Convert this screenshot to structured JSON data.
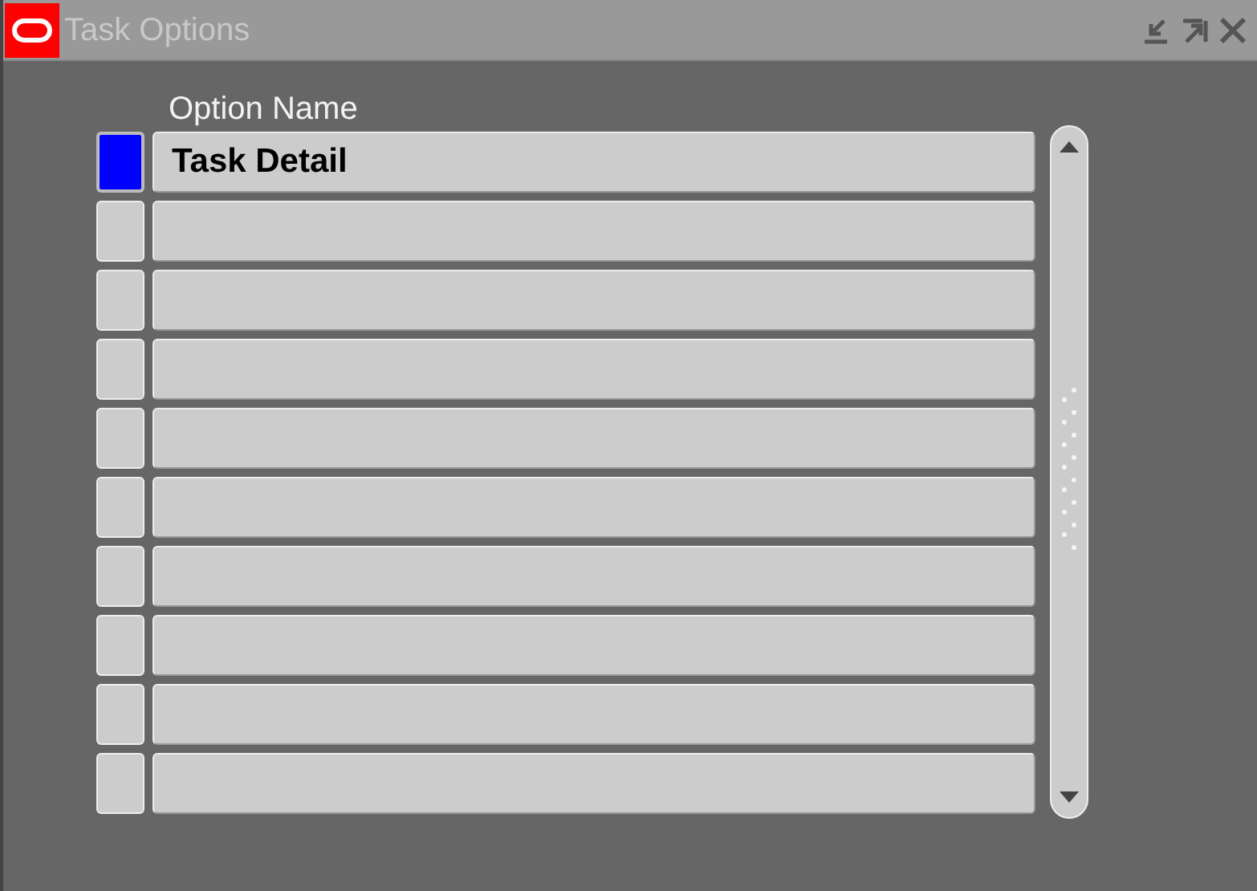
{
  "window": {
    "title": "Task Options"
  },
  "table": {
    "columns": [
      "Option Name"
    ],
    "rows": [
      {
        "value": "Task Detail",
        "selected": true
      },
      {
        "selected": false
      },
      {
        "selected": false
      },
      {
        "selected": false
      },
      {
        "selected": false
      },
      {
        "selected": false
      },
      {
        "selected": false
      },
      {
        "selected": false
      },
      {
        "selected": false
      },
      {
        "selected": false
      }
    ]
  }
}
